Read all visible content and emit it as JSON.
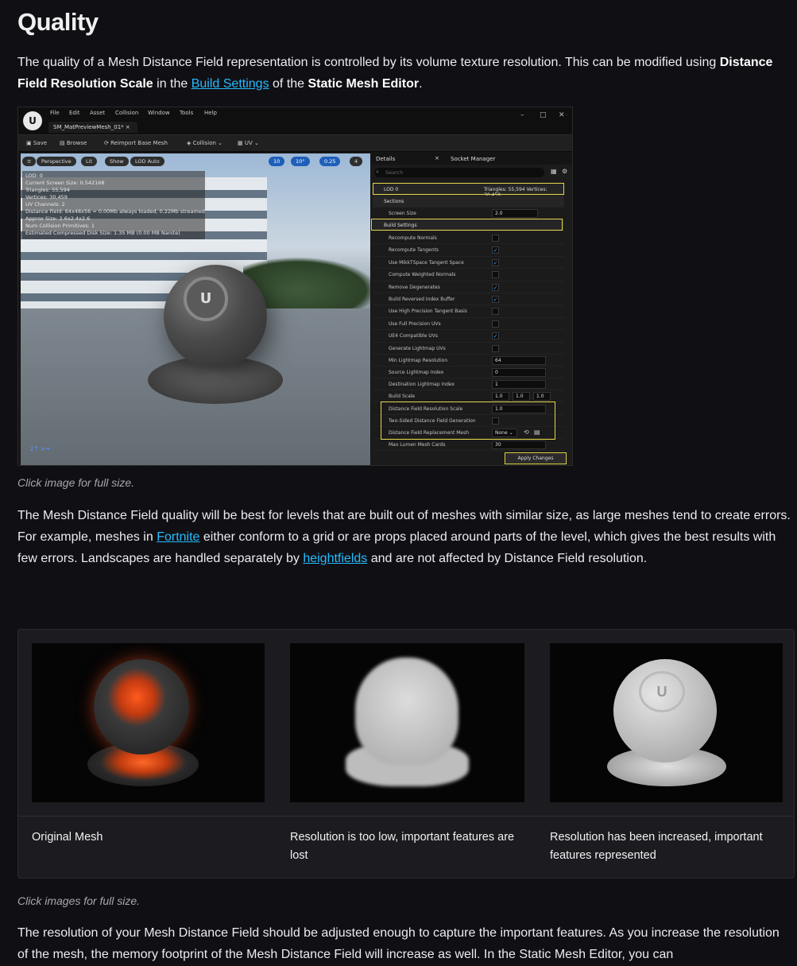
{
  "heading": "Quality",
  "intro": {
    "part1": "The quality of a Mesh Distance Field representation is controlled by its volume texture resolution. This can be modified using ",
    "bold1": "Distance Field Resolution Scale",
    "part2": " in the ",
    "link1": "Build Settings",
    "part3": " of the ",
    "bold2": "Static Mesh Editor",
    "part4": "."
  },
  "editor": {
    "menus": [
      "File",
      "Edit",
      "Asset",
      "Collision",
      "Window",
      "Tools",
      "Help"
    ],
    "tab_title": "SM_MatPreviewMesh_01*",
    "toolbar": [
      "Save",
      "Browse",
      "Reimport Base Mesh",
      "Collision",
      "UV"
    ],
    "viewport_buttons": [
      "Perspective",
      "Lit",
      "Show",
      "LOD Auto"
    ],
    "viewport_values": [
      "10",
      "10°",
      "0.25",
      "4"
    ],
    "stats": [
      "LOD: 0",
      "Current Screen Size: 0.542168",
      "Triangles: 55,594",
      "Vertices: 30,459",
      "UV Channels: 2",
      "Distance Field: 64x48x56 = 0.00Mb always loaded, 0.22Mb streamed",
      "Approx Size: 2.6x2.4x2.6",
      "Num Collision Primitives: 1",
      "Estimated Compressed Disk Size: 1.35 MB (0.00 MB Nanite)"
    ],
    "panel_tabs": {
      "details": "Details",
      "socket": "Socket Manager"
    },
    "search_placeholder": "Search",
    "lod_label": "LOD 0",
    "lod_stats": "Triangles: 55,594   Vertices: 30,459",
    "sections_label": "Sections",
    "screen_size_label": "Screen Size",
    "screen_size_value": "2.0",
    "build_settings_label": "Build Settings",
    "checkbox_rows": [
      {
        "label": "Recompute Normals",
        "checked": false
      },
      {
        "label": "Recompute Tangents",
        "checked": true
      },
      {
        "label": "Use MikkTSpace Tangent Space",
        "checked": true
      },
      {
        "label": "Compute Weighted Normals",
        "checked": false
      },
      {
        "label": "Remove Degenerates",
        "checked": true
      },
      {
        "label": "Build Reversed Index Buffer",
        "checked": true
      },
      {
        "label": "Use High Precision Tangent Basis",
        "checked": false
      },
      {
        "label": "Use Full Precision UVs",
        "checked": false
      },
      {
        "label": "UE4 Compatible UVs",
        "checked": true
      },
      {
        "label": "Generate Lightmap UVs",
        "checked": false
      }
    ],
    "min_lightmap_label": "Min Lightmap Resolution",
    "min_lightmap_value": "64",
    "source_lightmap_label": "Source Lightmap Index",
    "source_lightmap_value": "0",
    "dest_lightmap_label": "Destination Lightmap Index",
    "dest_lightmap_value": "1",
    "build_scale_label": "Build Scale",
    "build_scale_values": [
      "1.0",
      "1.0",
      "1.0"
    ],
    "df_res_label": "Distance Field Resolution Scale",
    "df_res_value": "1.0",
    "two_sided_label": "Two-Sided Distance Field Generation",
    "df_replace_label": "Distance Field Replacement Mesh",
    "df_replace_value": "None",
    "lumen_label": "Max Lumen Mesh Cards",
    "lumen_value": "30",
    "apply_label": "Apply Changes"
  },
  "caption1": "Click image for full size.",
  "para2": {
    "part1": "The Mesh Distance Field quality will be best for levels that are built out of meshes with similar size, as large meshes tend to create errors. For example, meshes in ",
    "link1": "Fortnite",
    "part2": " either conform to a grid or are props placed around parts of the level, which gives the best results with few errors. Landscapes are handled separately by ",
    "link2": "heightfields",
    "part3": " and are not affected by Distance Field resolution."
  },
  "gallery": {
    "captions": [
      "Original Mesh",
      "Resolution is too low, important features are lost",
      "Resolution has been increased, important features represented"
    ]
  },
  "caption2": "Click images for full size.",
  "para3": "The resolution of your Mesh Distance Field should be adjusted enough to capture the important features. As you increase the resolution of the mesh, the memory footprint of the Mesh Distance Field will increase as well. In the Static Mesh Editor, you can"
}
